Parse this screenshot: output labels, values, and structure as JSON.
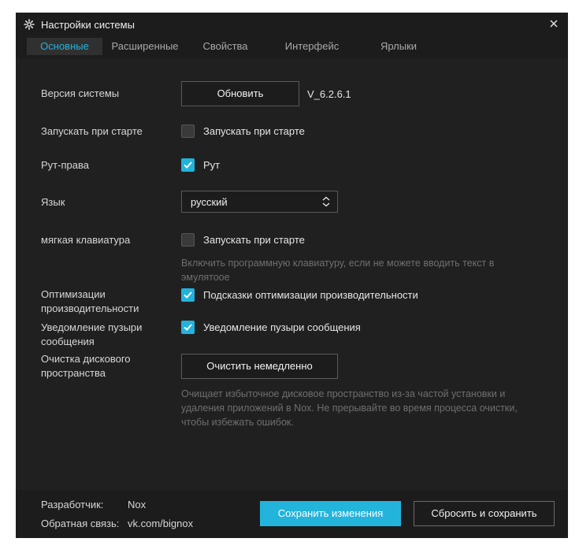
{
  "window": {
    "title": "Настройки системы",
    "close_icon": "close-icon",
    "gear_icon": "gear-icon"
  },
  "tabs": [
    {
      "label": "Основные",
      "active": true
    },
    {
      "label": "Расширенные",
      "active": false
    },
    {
      "label": "Свойства",
      "active": false
    },
    {
      "label": "Интерфейс",
      "active": false
    },
    {
      "label": "Ярлыки",
      "active": false
    }
  ],
  "settings": {
    "system_version": {
      "label": "Версия системы",
      "button": "Обновить",
      "version": "V_6.2.6.1"
    },
    "autostart": {
      "label": "Запускать при старте",
      "checkbox_label": "Запускать при старте",
      "checked": false
    },
    "root": {
      "label": "Рут-права",
      "checkbox_label": "Рут",
      "checked": true
    },
    "language": {
      "label": "Язык",
      "selected": "русский"
    },
    "soft_keyboard": {
      "label": "мягкая клавиатура",
      "checkbox_label": "Запускать при старте",
      "checked": false,
      "hint": "Включить программную клавиатуру, если не можете вводить текст в эмулятоое"
    },
    "performance": {
      "label": "Оптимизации производительности",
      "checkbox_label": "Подсказки оптимизации производительности",
      "checked": true
    },
    "bubbles": {
      "label": "Уведомление пузыри сообщения",
      "checkbox_label": "Уведомление пузыри сообщения",
      "checked": true
    },
    "disk_cleanup": {
      "label": "Очистка дискового пространства",
      "button": "Очистить немедленно",
      "hint": "Очищает избыточное дисковое пространство из-за частой установки и удаления приложений в Nox. Не прерывайте во время процесса очистки, чтобы избежать ошибок."
    }
  },
  "footer": {
    "developer_label": "Разработчик:",
    "developer_value": "Nox",
    "feedback_label": "Обратная связь:",
    "feedback_value": "vk.com/bignox",
    "save_button": "Сохранить изменения",
    "reset_button": "Сбросить и сохранить"
  },
  "colors": {
    "accent": "#23b4dc",
    "background": "#1c1c1c",
    "panel": "#202020",
    "hint_text": "#6f6f6f"
  }
}
